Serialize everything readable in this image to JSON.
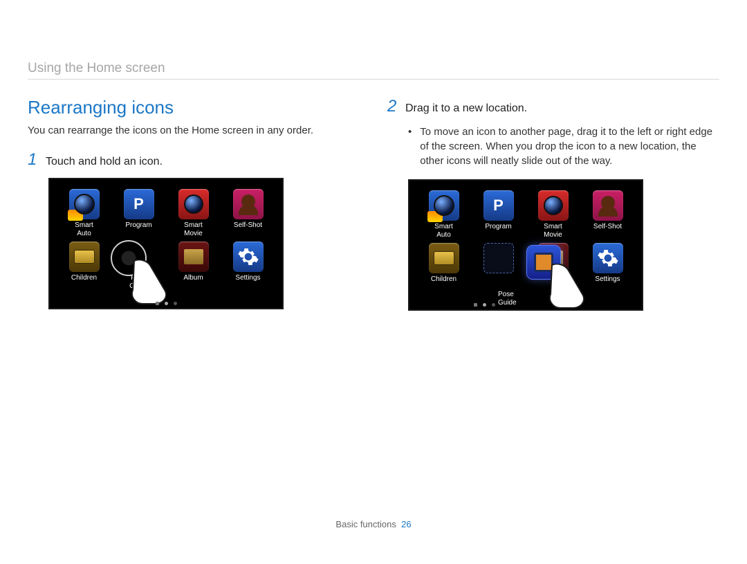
{
  "header": {
    "breadcrumb": "Using the Home screen"
  },
  "section": {
    "title": "Rearranging icons",
    "intro": "You can rearrange the icons on the Home screen in any order."
  },
  "steps": {
    "one": {
      "num": "1",
      "text": "Touch and hold an icon."
    },
    "two": {
      "num": "2",
      "text": "Drag it to a new location.",
      "bullet": "To move an icon to another page, drag it to the left or right edge of the screen. When you drop the icon to a new location, the other icons will neatly slide out of the way."
    }
  },
  "icons": {
    "smart_auto": "Smart\nAuto",
    "program": "Program",
    "program_glyph": "P",
    "smart_movie": "Smart\nMovie",
    "self_shot": "Self-Shot",
    "children": "Children",
    "pose_guide": "Pose\nGuide",
    "album": "Album",
    "settings": "Settings"
  },
  "footer": {
    "section": "Basic functions",
    "page": "26"
  }
}
